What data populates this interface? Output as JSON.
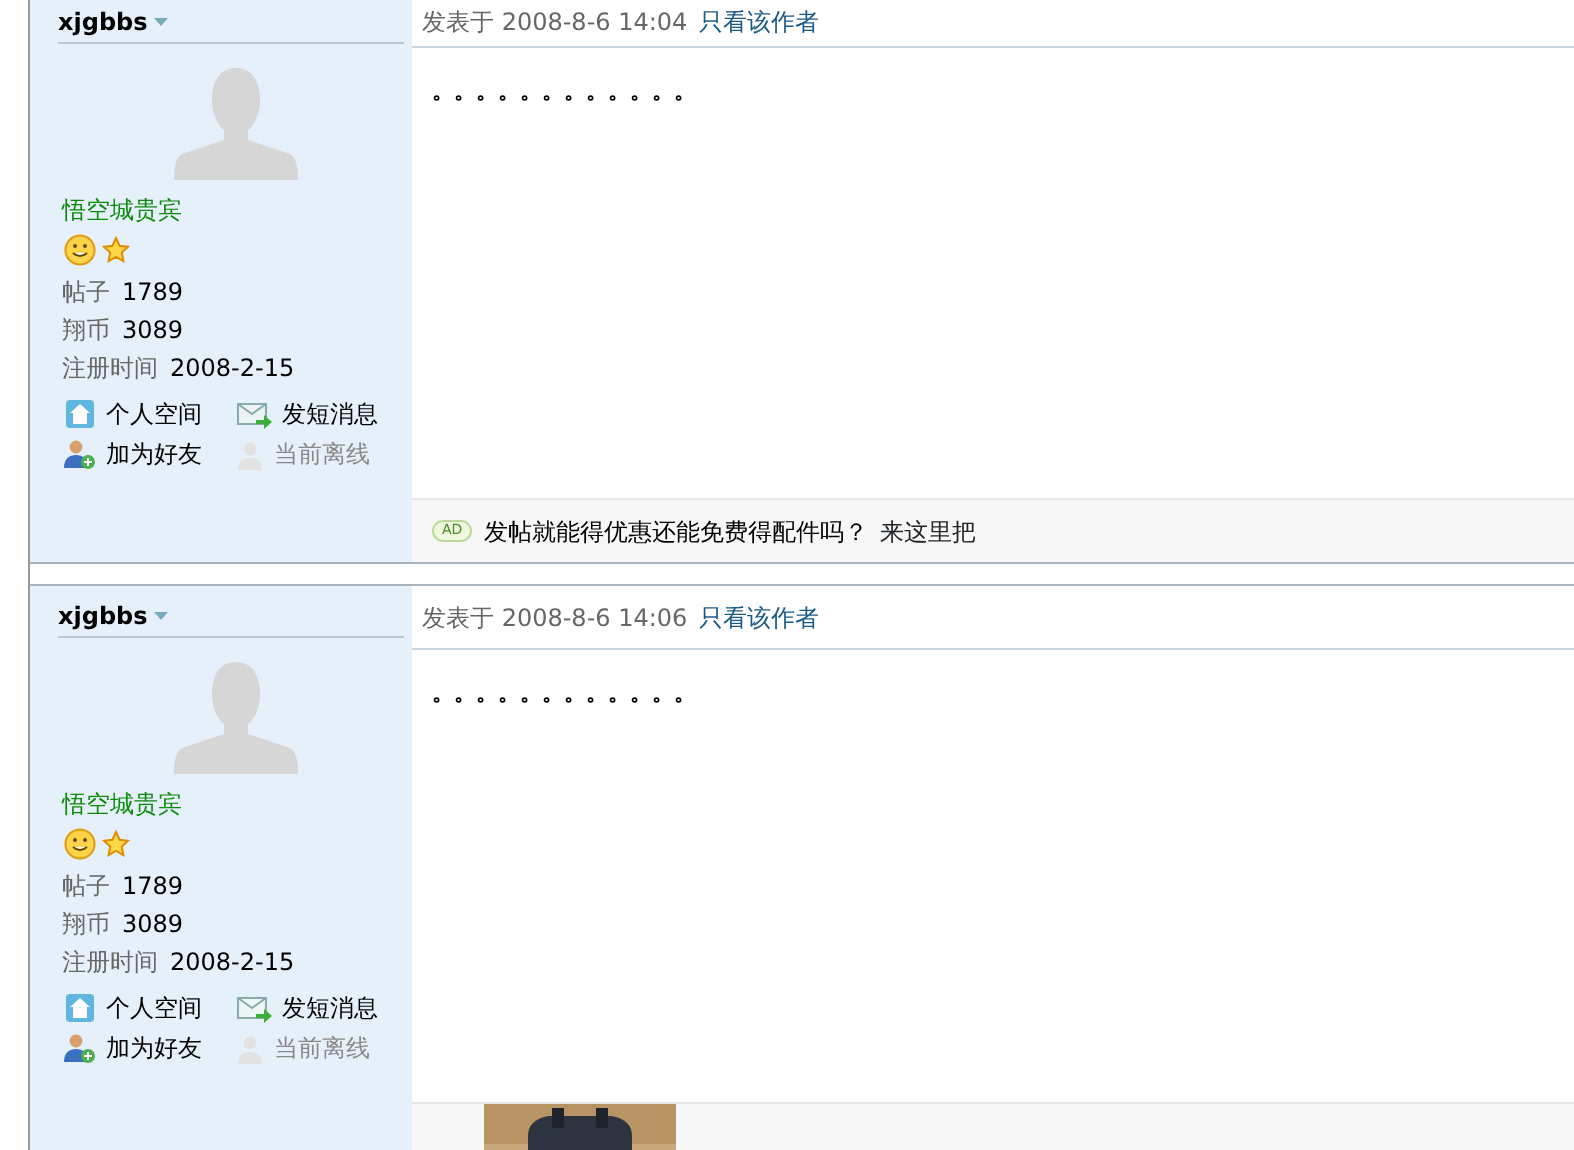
{
  "posts": [
    {
      "author": "xjgbbs",
      "group": "悟空城贵宾",
      "stats": [
        {
          "label": "帖子",
          "value": "1789"
        },
        {
          "label": "翔币",
          "value": "3089"
        },
        {
          "label": "注册时间",
          "value": "2008-2-15"
        }
      ],
      "links": {
        "space": "个人空间",
        "message": "发短消息",
        "add_friend": "加为好友",
        "status": "当前离线"
      },
      "online": false,
      "posted_label": "发表于",
      "time": "2008-8-6 14:04",
      "only_author": "只看该作者",
      "content": "。。。。。。。。。。。。",
      "ad": {
        "badge": "AD",
        "text": "发帖就能得优惠还能免费得配件吗？",
        "link": "来这里把"
      }
    },
    {
      "author": "xjgbbs",
      "group": "悟空城贵宾",
      "stats": [
        {
          "label": "帖子",
          "value": "1789"
        },
        {
          "label": "翔币",
          "value": "3089"
        },
        {
          "label": "注册时间",
          "value": "2008-2-15"
        }
      ],
      "links": {
        "space": "个人空间",
        "message": "发短消息",
        "add_friend": "加为好友",
        "status": "当前离线"
      },
      "online": false,
      "posted_label": "发表于",
      "time": "2008-8-6 14:06",
      "only_author": "只看该作者",
      "content": "。。。。。。。。。。。。"
    }
  ]
}
